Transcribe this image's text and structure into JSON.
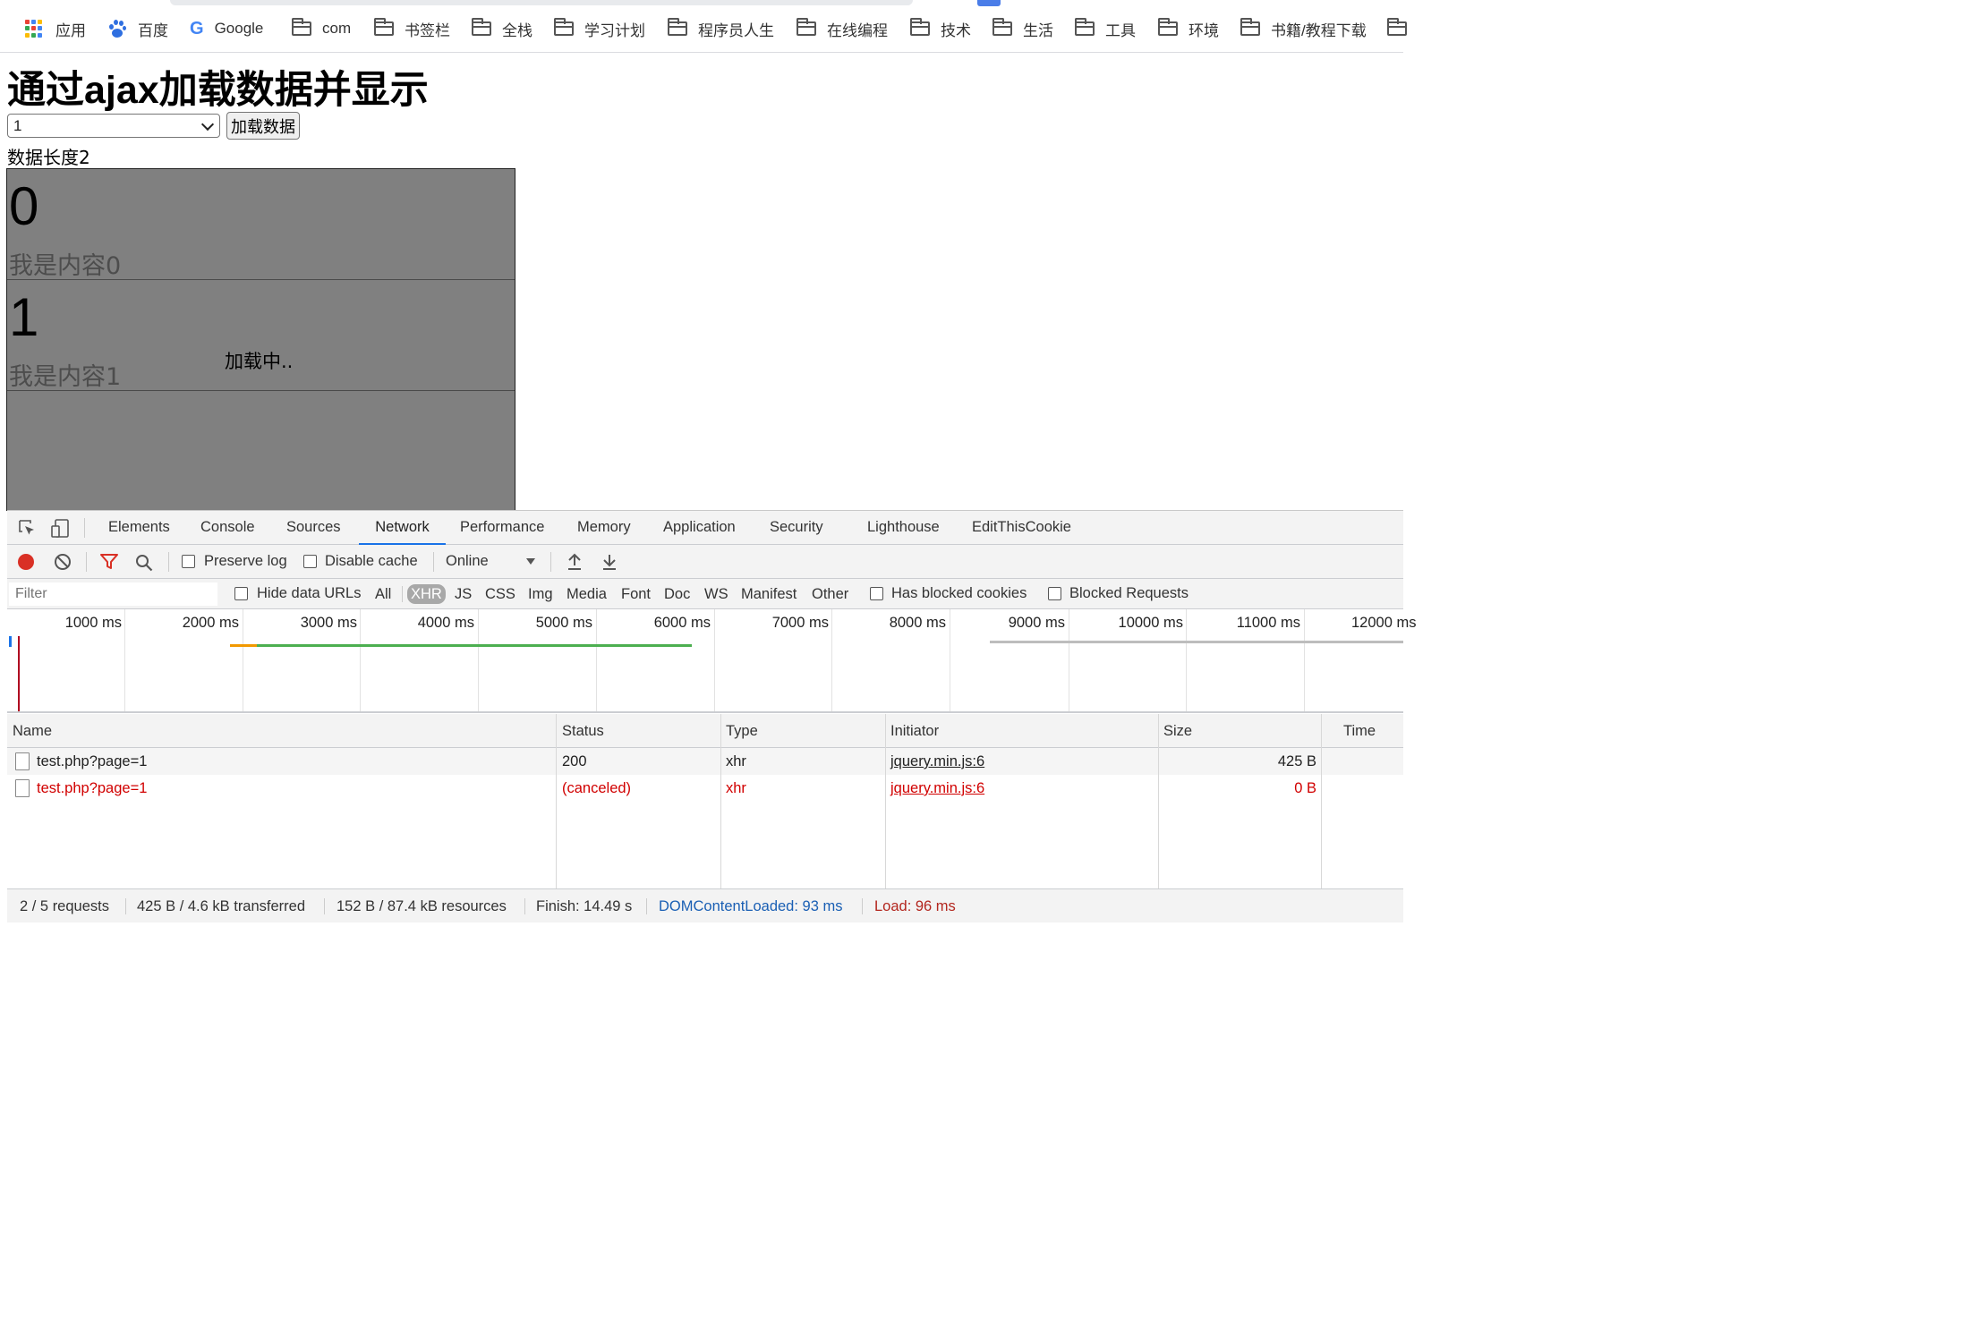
{
  "bookmarks": [
    {
      "label": "应用",
      "icon": "apps-grid-icon"
    },
    {
      "label": "百度",
      "icon": "baidu-paw-icon"
    },
    {
      "label": "Google",
      "icon": "google-g-icon"
    },
    {
      "label": "com",
      "icon": "folder-icon"
    },
    {
      "label": "书签栏",
      "icon": "folder-icon"
    },
    {
      "label": "全栈",
      "icon": "folder-icon"
    },
    {
      "label": "学习计划",
      "icon": "folder-icon"
    },
    {
      "label": "程序员人生",
      "icon": "folder-icon"
    },
    {
      "label": "在线编程",
      "icon": "folder-icon"
    },
    {
      "label": "技术",
      "icon": "folder-icon"
    },
    {
      "label": "生活",
      "icon": "folder-icon"
    },
    {
      "label": "工具",
      "icon": "folder-icon"
    },
    {
      "label": "环境",
      "icon": "folder-icon"
    },
    {
      "label": "书籍/教程下载",
      "icon": "folder-icon"
    }
  ],
  "page": {
    "title": "通过ajax加载数据并显示",
    "select_value": "1",
    "load_button": "加载数据",
    "data_length": "数据长度2",
    "items": [
      {
        "num": "0",
        "content": "我是内容0"
      },
      {
        "num": "1",
        "content": "我是内容1"
      }
    ],
    "loading": "加载中.."
  },
  "devtools": {
    "tabs": [
      "Elements",
      "Console",
      "Sources",
      "Network",
      "Performance",
      "Memory",
      "Application",
      "Security",
      "Lighthouse",
      "EditThisCookie"
    ],
    "active_tab": "Network",
    "toolbar": {
      "preserve_log": "Preserve log",
      "disable_cache": "Disable cache",
      "throttling": "Online"
    },
    "filter": {
      "placeholder": "Filter",
      "hide_data_urls": "Hide data URLs",
      "types": [
        "All",
        "XHR",
        "JS",
        "CSS",
        "Img",
        "Media",
        "Font",
        "Doc",
        "WS",
        "Manifest",
        "Other"
      ],
      "active_type": "XHR",
      "has_blocked_cookies": "Has blocked cookies",
      "blocked_requests": "Blocked Requests"
    },
    "timeline_labels": [
      "1000 ms",
      "2000 ms",
      "3000 ms",
      "4000 ms",
      "5000 ms",
      "6000 ms",
      "7000 ms",
      "8000 ms",
      "9000 ms",
      "10000 ms",
      "11000 ms",
      "12000 ms"
    ],
    "columns": [
      "Name",
      "Status",
      "Type",
      "Initiator",
      "Size",
      "Time"
    ],
    "rows": [
      {
        "name": "test.php?page=1",
        "status": "200",
        "type": "xhr",
        "initiator": "jquery.min.js:6",
        "size": "425 B",
        "error": false
      },
      {
        "name": "test.php?page=1",
        "status": "(canceled)",
        "type": "xhr",
        "initiator": "jquery.min.js:6",
        "size": "0 B",
        "error": true
      }
    ],
    "status_bar": {
      "requests": "2 / 5 requests",
      "transferred": "425 B / 4.6 kB transferred",
      "resources": "152 B / 87.4 kB resources",
      "finish": "Finish: 14.49 s",
      "dom_content_loaded": "DOMContentLoaded: 93 ms",
      "load": "Load: 96 ms"
    },
    "colors": {
      "accent": "#1a73e8",
      "error": "#d10000",
      "record": "#d93025",
      "filter_icon": "#d93025"
    }
  }
}
